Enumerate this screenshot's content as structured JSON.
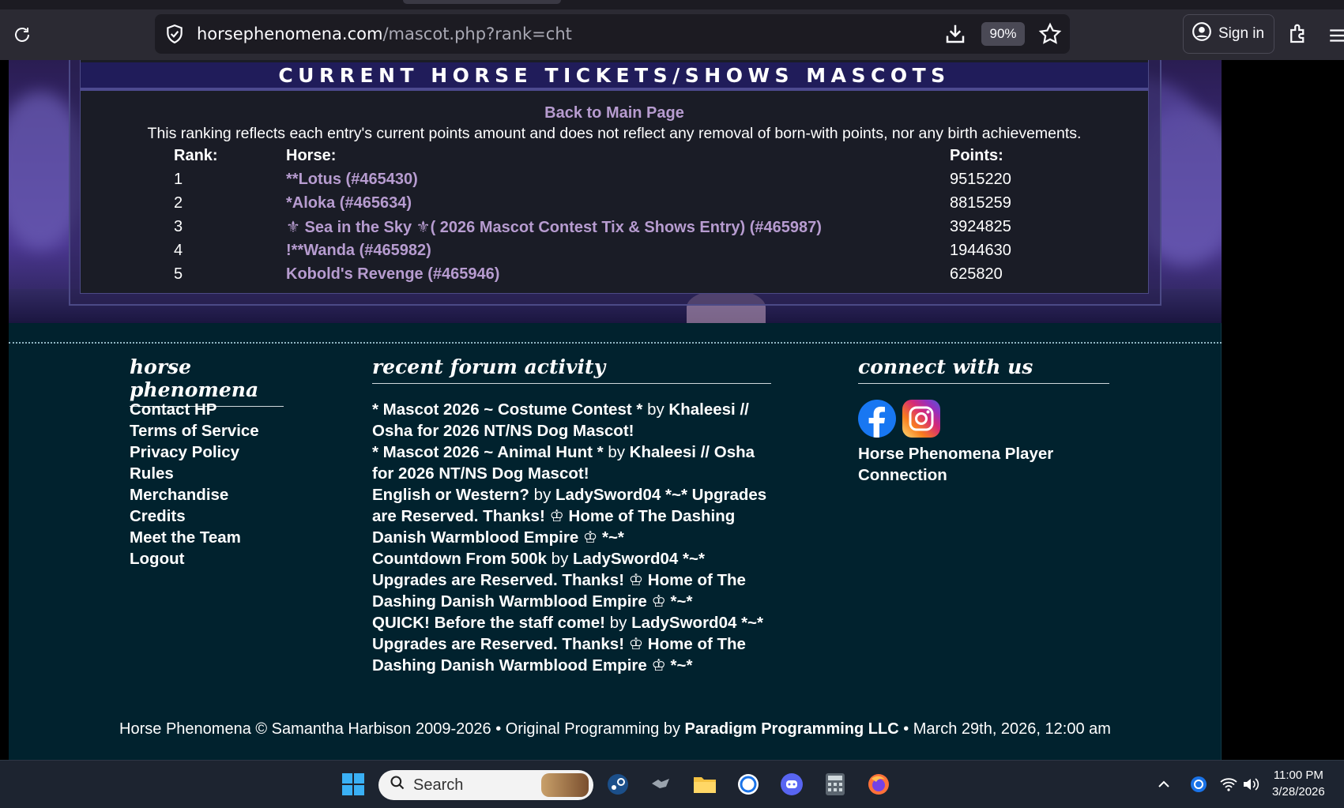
{
  "browser": {
    "url_domain": "horsephenomena.com",
    "url_path": "/mascot.php?rank=cht",
    "zoom": "90%",
    "signin_label": "Sign in"
  },
  "panel": {
    "title": "CURRENT HORSE TICKETS/SHOWS MASCOTS",
    "back_link": "Back to Main Page",
    "disclaimer": "This ranking reflects each entry's current points amount and does not reflect any removal of born-with points, nor any birth achievements.",
    "headers": {
      "rank": "Rank:",
      "horse": "Horse:",
      "points": "Points:"
    },
    "rows": [
      {
        "rank": "1",
        "horse": "**Lotus (#465430)",
        "points": "9515220"
      },
      {
        "rank": "2",
        "horse": "*Aloka (#465634)",
        "points": "8815259"
      },
      {
        "rank": "3",
        "horse": "⚜ Sea in the Sky ⚜( 2026 Mascot Contest Tix & Shows Entry) (#465987)",
        "points": "3924825"
      },
      {
        "rank": "4",
        "horse": "!**Wanda (#465982)",
        "points": "1944630"
      },
      {
        "rank": "5",
        "horse": "Kobold's Revenge (#465946)",
        "points": "625820"
      }
    ]
  },
  "footer": {
    "hp_heading": "horse phenomena",
    "forum_heading": "recent forum activity",
    "connect_heading": "connect with us",
    "links": [
      "Contact HP",
      "Terms of Service",
      "Privacy Policy",
      "Rules",
      "Merchandise",
      "Credits",
      "Meet the Team",
      "Logout"
    ],
    "forum_posts": [
      {
        "topic": "* Mascot 2026 ~ Costume Contest *",
        "by": "by",
        "author": "Khaleesi // Osha for 2026 NT/NS Dog Mascot!"
      },
      {
        "topic": "* Mascot 2026 ~ Animal Hunt *",
        "by": "by",
        "author": "Khaleesi // Osha for 2026 NT/NS Dog Mascot!"
      },
      {
        "topic": "English or Western?",
        "by": "by",
        "author": "LadySword04 *~* Upgrades are Reserved. Thanks! ♔ Home of The Dashing Danish Warmblood Empire ♔ *~*"
      },
      {
        "topic": "Countdown From 500k",
        "by": "by",
        "author": "LadySword04 *~* Upgrades are Reserved. Thanks! ♔ Home of The Dashing Danish Warmblood Empire ♔ *~*"
      },
      {
        "topic": "QUICK! Before the staff come!",
        "by": "by",
        "author": "LadySword04 *~* Upgrades are Reserved. Thanks! ♔ Home of The Dashing Danish Warmblood Empire ♔ *~*"
      }
    ],
    "player_connection": "Horse Phenomena Player Connection",
    "copyright_a": "Horse Phenomena © Samantha Harbison 2009-2026  •  Original Programming by ",
    "copyright_b": "Paradigm Programming LLC",
    "copyright_c": "  •  March 29th, 2026, 12:00 am"
  },
  "taskbar": {
    "search_label": "Search",
    "time": "11:00 PM",
    "date": "3/28/2026"
  },
  "colors": {
    "link_purple": "#b79cd0",
    "panel_title_bg": "#201c5a",
    "footer_bg": "#01222e"
  }
}
